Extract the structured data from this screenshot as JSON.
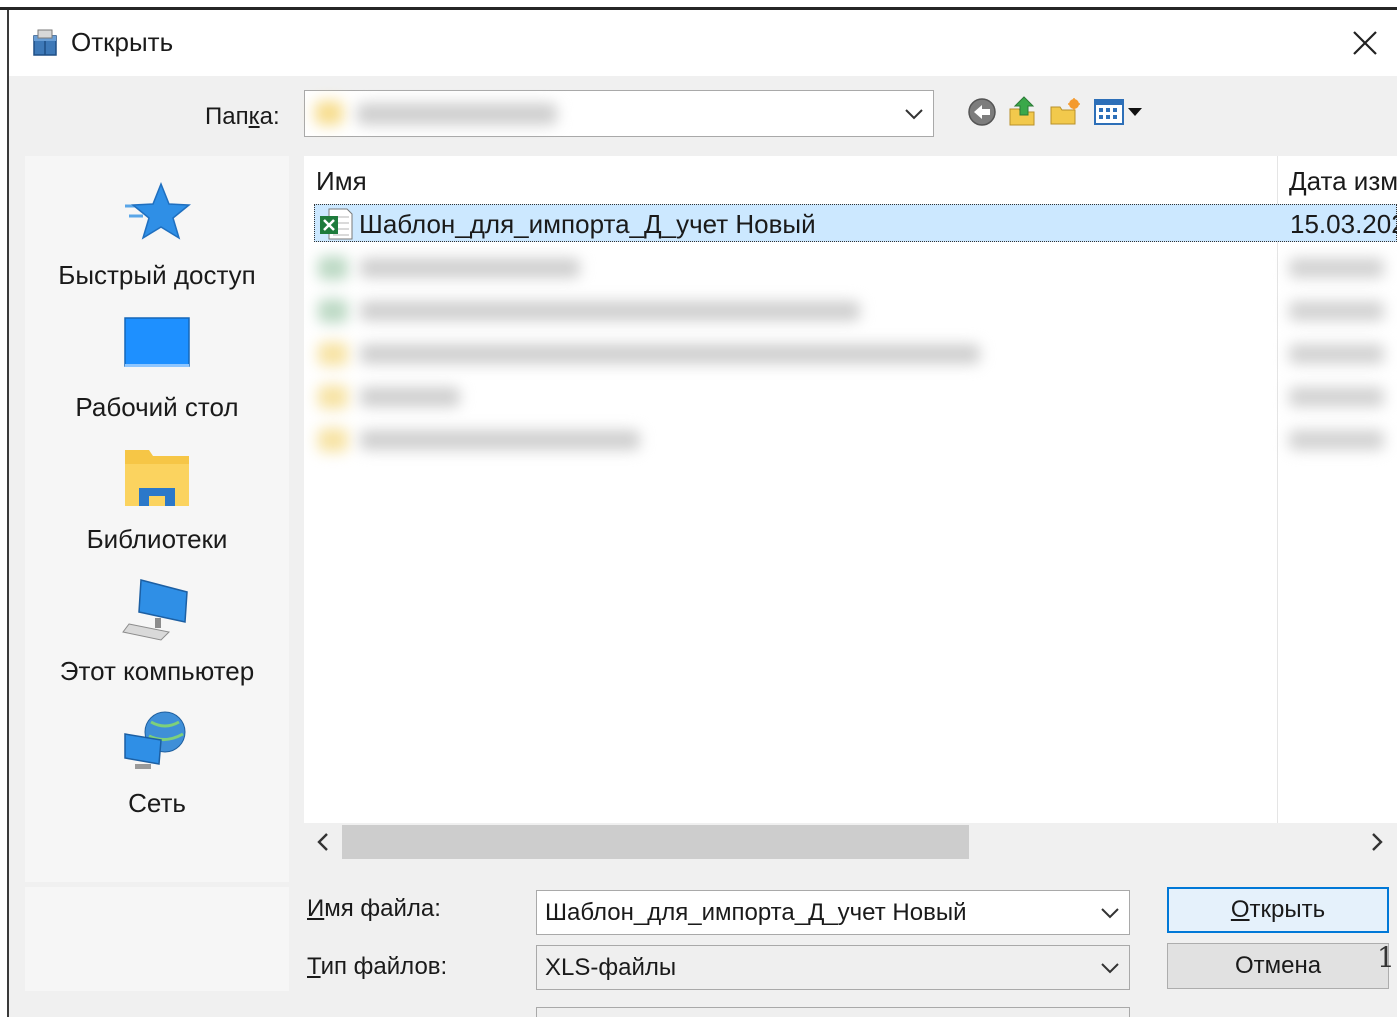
{
  "window": {
    "title": "Открыть",
    "icon": "open-box-icon",
    "close_glyph": "✕"
  },
  "toolbar": {
    "look_in_label_pre": "Пап",
    "look_in_label_acc": "к",
    "look_in_label_post": "а:",
    "look_in_value": "",
    "icons": [
      "back-icon",
      "up-folder-icon",
      "new-folder-icon",
      "view-menu-icon"
    ]
  },
  "places": [
    {
      "label": "Быстрый доступ",
      "icon": "quick-access-star-icon"
    },
    {
      "label": "Рабочий стол",
      "icon": "desktop-icon"
    },
    {
      "label": "Библиотеки",
      "icon": "libraries-icon"
    },
    {
      "label": "Этот компьютер",
      "icon": "computer-icon"
    },
    {
      "label": "Сеть",
      "icon": "network-icon"
    }
  ],
  "file_list": {
    "columns": {
      "name": "Имя",
      "date": "Дата изм"
    },
    "selected_file": {
      "name": "Шаблон_для_импорта_Д_учет Новый",
      "date": "15.03.202",
      "icon": "excel-file-icon"
    },
    "scroll_left_glyph": "‹",
    "scroll_right_glyph": "›"
  },
  "footer": {
    "filename_label_acc": "И",
    "filename_label_rest": "мя файла:",
    "filename_value": "Шаблон_для_импорта_Д_учет Новый",
    "filetype_label_acc": "Т",
    "filetype_label_rest": "ип файлов:",
    "filetype_value": "XLS-файлы",
    "open_button_acc": "О",
    "open_button_rest": "ткрыть",
    "cancel_button": "Отмена",
    "edge_glyph": "1"
  },
  "colors": {
    "accent": "#0078d7",
    "selection": "#cce8ff",
    "dialog_bg": "#f0f0f0"
  }
}
